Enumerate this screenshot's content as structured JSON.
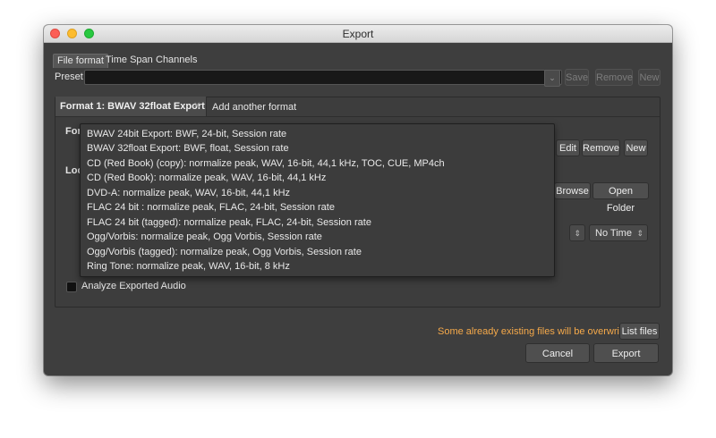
{
  "window": {
    "title": "Export"
  },
  "tabs": [
    "File format",
    "Time Span",
    "Channels"
  ],
  "preset": {
    "label": "Preset",
    "value": "",
    "buttons": {
      "save": "Save",
      "remove": "Remove",
      "new": "New"
    }
  },
  "format_tabs": {
    "active": "Format 1: BWAV 32float Export",
    "add": "Add another format"
  },
  "format_row": {
    "label_partial": "For",
    "edit": "Edit",
    "remove": "Remove",
    "new": "New"
  },
  "location_row": {
    "label_partial": "Loc",
    "browse": "Browse",
    "open_folder": "Open Folder"
  },
  "time_format": {
    "value": "No Time"
  },
  "dropdown_items": [
    "BWAV 24bit Export: BWF, 24-bit, Session rate",
    "BWAV 32float Export: BWF, float, Session rate",
    "CD (Red Book) (copy): normalize peak, WAV, 16-bit, 44,1 kHz, TOC, CUE, MP4ch",
    "CD (Red Book): normalize peak, WAV, 16-bit, 44,1 kHz",
    "DVD-A: normalize peak, WAV, 16-bit, 44,1 kHz",
    "FLAC 24 bit : normalize peak, FLAC, 24-bit, Session rate",
    "FLAC 24 bit (tagged): normalize peak, FLAC, 24-bit, Session rate",
    "Ogg/Vorbis: normalize peak, Ogg Vorbis, Session rate",
    "Ogg/Vorbis (tagged): normalize peak, Ogg Vorbis, Session rate",
    "Ring Tone: normalize peak, WAV, 16-bit, 8 kHz"
  ],
  "analyze": {
    "label": "Analyze Exported Audio",
    "checked": false
  },
  "warning": "Some already existing files will be overwritten.",
  "list_files": "List files",
  "cancel": "Cancel",
  "export": "Export",
  "colors": {
    "warning": "#f5a94a",
    "window_bg": "#3e3e3e"
  }
}
